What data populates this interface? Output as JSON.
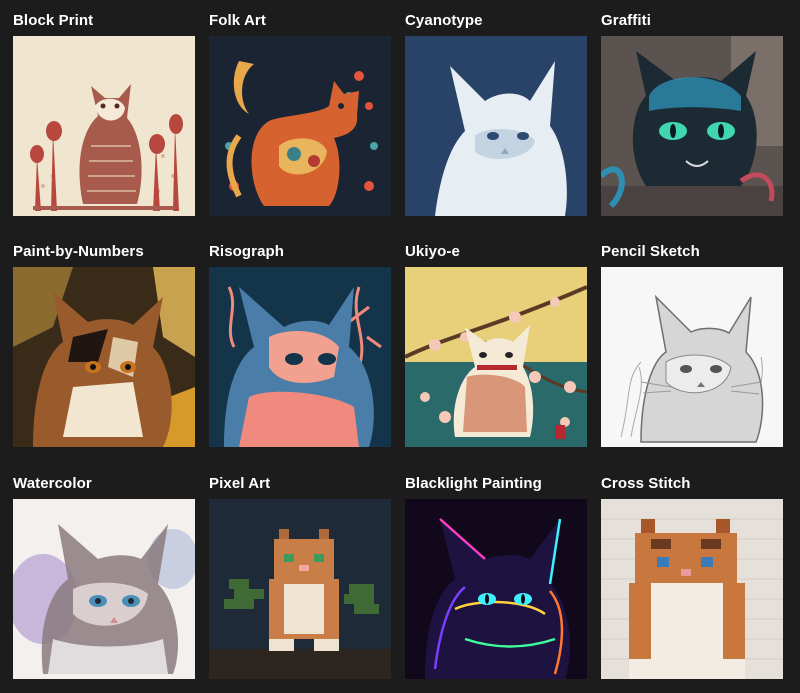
{
  "gallery": {
    "subject": "cat",
    "styles": [
      {
        "label": "Block Print",
        "art": "blockprint"
      },
      {
        "label": "Folk Art",
        "art": "folkart"
      },
      {
        "label": "Cyanotype",
        "art": "cyanotype"
      },
      {
        "label": "Graffiti",
        "art": "graffiti"
      },
      {
        "label": "Paint-by-Numbers",
        "art": "paintbynumbers"
      },
      {
        "label": "Risograph",
        "art": "risograph"
      },
      {
        "label": "Ukiyo-e",
        "art": "ukiyoe"
      },
      {
        "label": "Pencil Sketch",
        "art": "pencil"
      },
      {
        "label": "Watercolor",
        "art": "watercolor"
      },
      {
        "label": "Pixel Art",
        "art": "pixelart"
      },
      {
        "label": "Blacklight Painting",
        "art": "blacklight"
      },
      {
        "label": "Cross Stitch",
        "art": "crossstitch"
      }
    ]
  }
}
